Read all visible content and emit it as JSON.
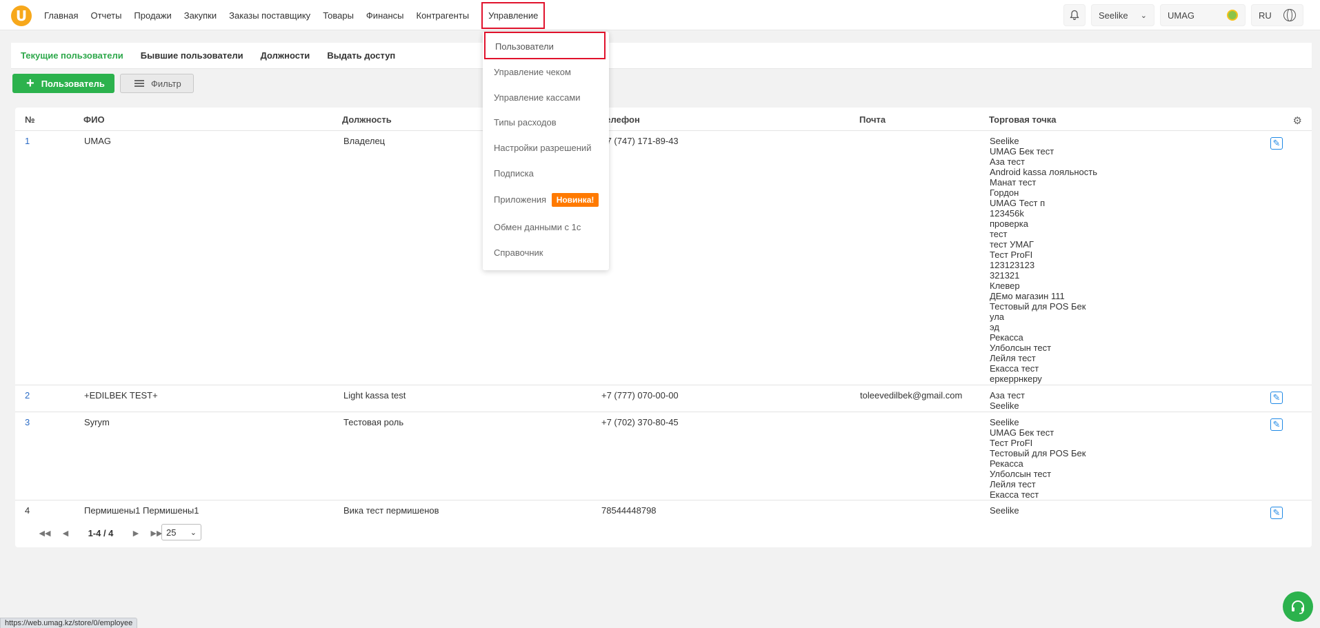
{
  "nav": {
    "items": [
      "Главная",
      "Отчеты",
      "Продажи",
      "Закупки",
      "Заказы поставщику",
      "Товары",
      "Финансы",
      "Контрагенты"
    ],
    "active": "Управление"
  },
  "topbar": {
    "store": "Seelike",
    "user": "UMAG",
    "lang": "RU"
  },
  "tabs": [
    "Текущие пользователи",
    "Бывшие пользователи",
    "Должности",
    "Выдать доступ"
  ],
  "actions": {
    "add_label": "Пользователь",
    "filter_label": "Фильтр"
  },
  "table": {
    "headers": {
      "num": "№",
      "name": "ФИО",
      "position": "Должность",
      "phone": "Телефон",
      "email": "Почта",
      "store": "Торговая точка"
    },
    "rows": [
      {
        "num": "1",
        "name": "UMAG",
        "position": "Владелец",
        "phone": "+7 (747) 171-89-43",
        "email": "",
        "stores": [
          "Seelike",
          "UMAG Бек тест",
          "Аза тест",
          "Android kassa лояльность",
          "Манат тест",
          "Гордон",
          "UMAG Тест п",
          "123456k",
          "проверка",
          "тест",
          "тест УМАГ",
          "Тест ProFI",
          "123123123",
          "321321",
          "Клевер",
          "ДЕмо магазин 111",
          "Тестовый для POS Бек",
          "ула",
          "эд",
          "Рекасса",
          "Улболсын тест",
          "Лейля тест",
          "Екасса тест",
          "еркеррнкеру"
        ]
      },
      {
        "num": "2",
        "name": "+EDILBEK TEST+",
        "position": "Light kassa test",
        "phone": "+7 (777) 070-00-00",
        "email": "toleevedilbek@gmail.com",
        "stores": [
          "Аза тест",
          "Seelike"
        ]
      },
      {
        "num": "3",
        "name": "Syrym",
        "position": "Тестовая роль",
        "phone": "+7 (702) 370-80-45",
        "email": "",
        "stores": [
          "Seelike",
          "UMAG Бек тест",
          "Тест ProFI",
          "Тестовый для POS Бек",
          "Рекасса",
          "Улболсын тест",
          "Лейля тест",
          "Екасса тест"
        ]
      },
      {
        "num": "4",
        "name": "Пермишены1 Пермишены1",
        "position": "Вика тест пермишенов",
        "phone": "78544448798",
        "email": "",
        "stores": [
          "Seelike"
        ]
      }
    ]
  },
  "pagination": {
    "range": "1-4 / 4",
    "per_page": "25"
  },
  "dropdown": {
    "items": [
      "Пользователи",
      "Управление чеком",
      "Управление кассами",
      "Типы расходов",
      "Настройки разрешений",
      "Подписка",
      "Приложения",
      "Обмен данными с 1с",
      "Справочник"
    ],
    "badge": "Новинка!"
  },
  "status_url": "https://web.umag.kz/store/0/employee"
}
